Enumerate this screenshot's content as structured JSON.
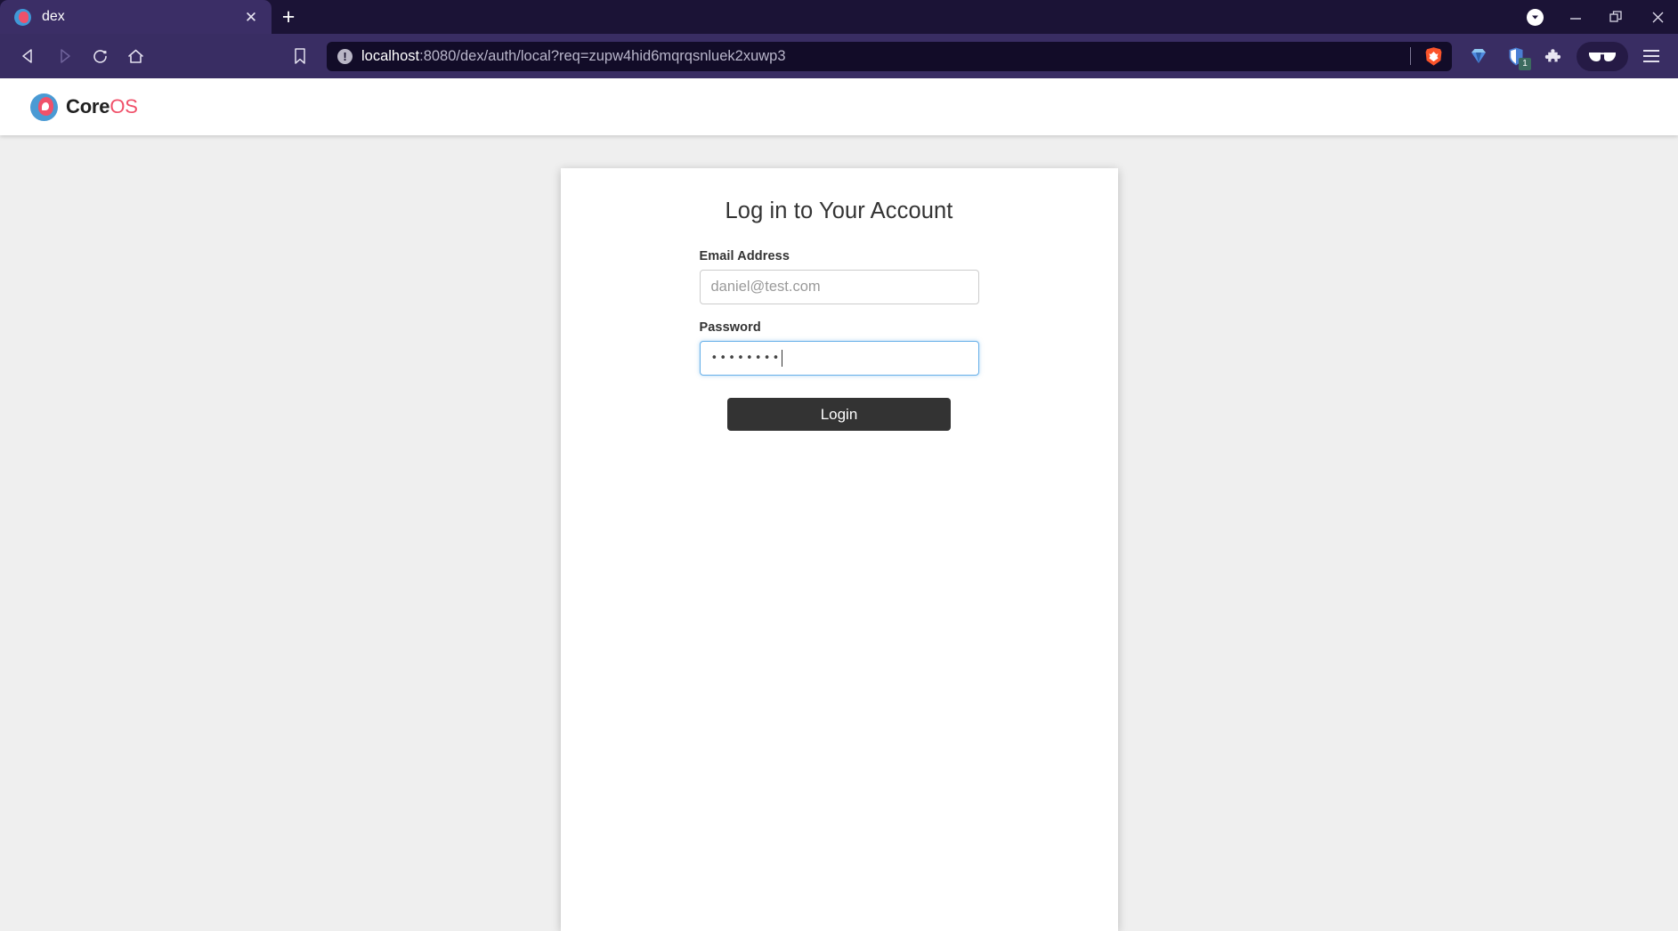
{
  "browser": {
    "tab": {
      "title": "dex",
      "favicon_name": "coreos-favicon",
      "close_label": "✕"
    },
    "new_tab_label": "+",
    "window_controls": {
      "tab_search_label": "▾",
      "minimize_label": "—",
      "maximize_label": "❐",
      "close_label": "✕"
    },
    "nav": {
      "back_label": "◁",
      "forward_label": "▷",
      "reload_label": "⟳",
      "home_label": "⌂",
      "bookmark_label": "☆"
    },
    "url": {
      "info_icon_label": "!",
      "host": "localhost",
      "path": ":8080/dex/auth/local?req=zupw4hid6mqrqsnluek2xuwp3",
      "full": "localhost:8080/dex/auth/local?req=zupw4hid6mqrqsnluek2xuwp3",
      "brave_shield_name": "brave-lion-icon"
    },
    "toolbar": {
      "rewards_icon": "brave-rewards-triangle-icon",
      "shield_icon": "shields-icon",
      "shield_badge_count": "1",
      "extensions_icon": "puzzle-piece-icon",
      "profile_icon": "sunglasses-icon",
      "menu_icon": "hamburger-menu-icon"
    }
  },
  "page": {
    "brand": {
      "core": "Core",
      "os": "OS"
    },
    "login": {
      "title": "Log in to Your Account",
      "email": {
        "label": "Email Address",
        "placeholder": "daniel@test.com",
        "value": ""
      },
      "password": {
        "label": "Password",
        "value": "••••••••",
        "placeholder": ""
      },
      "submit_label": "Login"
    }
  },
  "colors": {
    "tabstrip_bg": "#1b1336",
    "tab_active_bg": "#3b2e66",
    "navbar_bg": "#392d63",
    "urlbar_bg": "#120c28",
    "page_bg": "#efefef",
    "card_bg": "#ffffff",
    "button_bg": "#333333",
    "focus_border": "#66afe9",
    "brand_accent": "#f0516a",
    "brand_blue": "#4a9ad4",
    "brave_orange": "#fb542b"
  }
}
